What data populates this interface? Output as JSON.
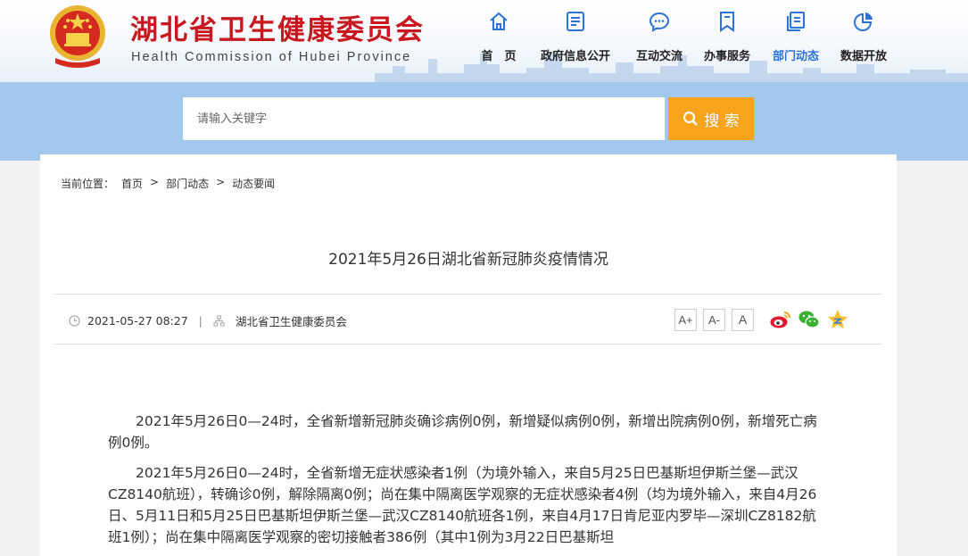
{
  "header": {
    "title": "湖北省卫生健康委员会",
    "subtitle": "Health Commission of Hubei Province",
    "nav": [
      {
        "label": "首　页",
        "icon": "home-icon"
      },
      {
        "label": "政府信息公开",
        "icon": "document-icon"
      },
      {
        "label": "互动交流",
        "icon": "chat-bubble-icon"
      },
      {
        "label": "办事服务",
        "icon": "bookmark-icon"
      },
      {
        "label": "部门动态",
        "icon": "files-icon",
        "active": true
      },
      {
        "label": "数据开放",
        "icon": "pie-chart-icon"
      }
    ]
  },
  "search": {
    "placeholder": "请输入关键字",
    "button_label": "搜 索"
  },
  "breadcrumb": {
    "lead": "当前位置：",
    "items": [
      "首页",
      "部门动态",
      "动态要闻"
    ],
    "separator": ">"
  },
  "article": {
    "title": "2021年5月26日湖北省新冠肺炎疫情情况",
    "date": "2021-05-27 08:27",
    "divider": "|",
    "source": "湖北省卫生健康委员会",
    "font_buttons": [
      "A+",
      "A-",
      "A"
    ],
    "share": [
      "weibo-icon",
      "wechat-icon",
      "qzone-icon"
    ],
    "paragraphs": [
      "2021年5月26日0—24时，全省新增新冠肺炎确诊病例0例，新增疑似病例0例，新增出院病例0例，新增死亡病例0例。",
      "2021年5月26日0—24时，全省新增无症状感染者1例（为境外输入，来自5月25日巴基斯坦伊斯兰堡—武汉CZ8140航班），转确诊0例，解除隔离0例；尚在集中隔离医学观察的无症状感染者4例（均为境外输入，来自4月26日、5月11日和5月25日巴基斯坦伊斯兰堡—武汉CZ8140航班各1例，来自4月17日肯尼亚内罗毕—深圳CZ8182航班1例）；尚在集中隔离医学观察的密切接触者386例（其中1例为3月22日巴基斯坦"
    ]
  },
  "colors": {
    "brand_red": "#c8171e",
    "nav_active": "#2b73d8",
    "band_blue": "#a3c8ee",
    "search_orange": "#f7a31b"
  }
}
